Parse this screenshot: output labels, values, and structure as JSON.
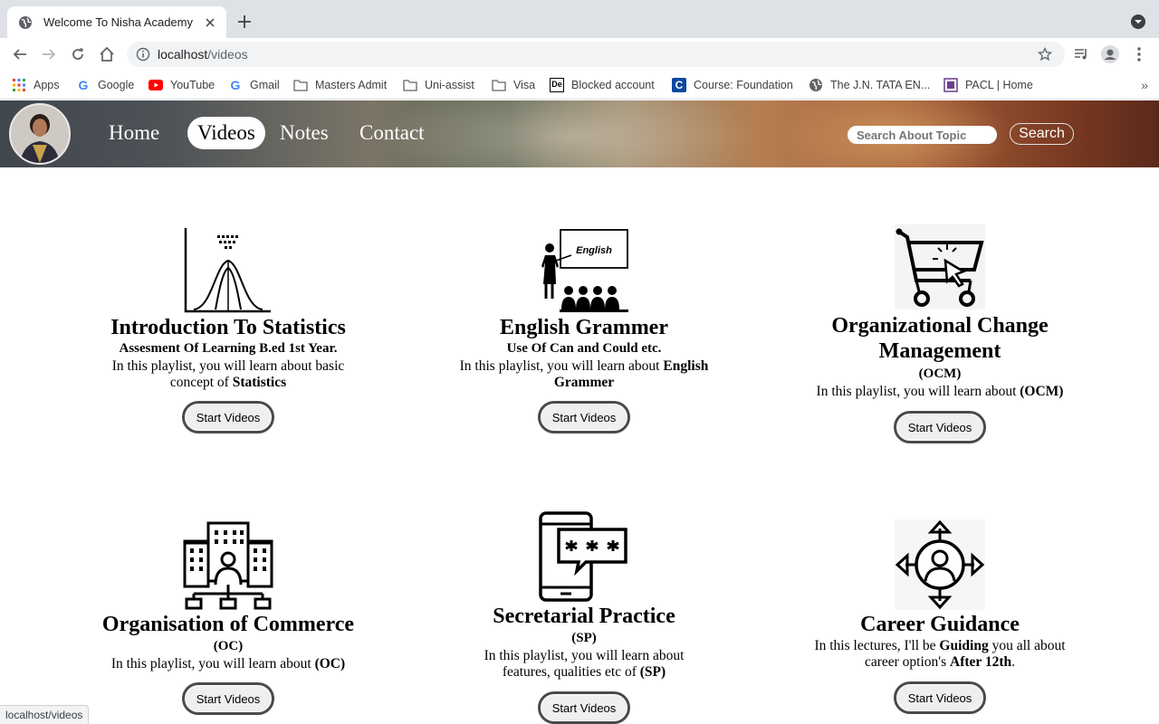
{
  "browser": {
    "tab_title": "Welcome To Nisha Academy",
    "url_host": "localhost",
    "url_path": "/videos",
    "bookmarks": [
      {
        "label": "Apps",
        "icon": "apps-grid-icon"
      },
      {
        "label": "Google",
        "icon": "google-icon"
      },
      {
        "label": "YouTube",
        "icon": "youtube-icon"
      },
      {
        "label": "Gmail",
        "icon": "google-icon"
      },
      {
        "label": "Masters Admit",
        "icon": "folder-icon"
      },
      {
        "label": "Uni-assist",
        "icon": "folder-icon"
      },
      {
        "label": "Visa",
        "icon": "folder-icon"
      },
      {
        "label": "Blocked account",
        "icon": "deutsche-bank-icon"
      },
      {
        "label": "Course: Foundation",
        "icon": "coursera-icon"
      },
      {
        "label": "The J.N. TATA EN...",
        "icon": "globe-icon"
      },
      {
        "label": "PACL | Home",
        "icon": "pacl-icon"
      }
    ],
    "status_url": "localhost/videos"
  },
  "site": {
    "nav": [
      {
        "label": "Home",
        "active": false
      },
      {
        "label": "Videos",
        "active": true
      },
      {
        "label": "Notes",
        "active": false
      },
      {
        "label": "Contact",
        "active": false
      }
    ],
    "search_placeholder": "Search About Topic",
    "search_button": "Search"
  },
  "cards": [
    {
      "title": "Introduction To Statistics",
      "subtitle": "Assesment Of Learning B.ed 1st Year.",
      "desc_prefix": "In this playlist, you will learn about basic concept of ",
      "desc_bold": "Statistics",
      "desc_suffix": "",
      "button": "Start Videos",
      "icon": "bell-curve-icon"
    },
    {
      "title": "English Grammer",
      "subtitle": "Use Of Can and Could etc.",
      "desc_prefix": "In this playlist, you will learn about ",
      "desc_bold": "English Grammer",
      "desc_suffix": "",
      "button": "Start Videos",
      "icon": "classroom-icon",
      "board_text": "English"
    },
    {
      "title": "Organizational Change Management",
      "subtitle": "(OCM)",
      "desc_prefix": "In this playlist, you will learn about ",
      "desc_bold": "(OCM)",
      "desc_suffix": "",
      "button": "Start Videos",
      "icon": "shopping-cart-icon"
    },
    {
      "title": "Organisation of Commerce",
      "subtitle": "(OC)",
      "desc_prefix": "In this playlist, you will learn about ",
      "desc_bold": "(OC)",
      "desc_suffix": "",
      "button": "Start Videos",
      "icon": "office-buildings-icon"
    },
    {
      "title": "Secretarial Practice",
      "subtitle": "(SP)",
      "desc_prefix": "In this playlist, you will learn about features, qualities etc of ",
      "desc_bold": "(SP)",
      "desc_suffix": "",
      "button": "Start Videos",
      "icon": "phone-password-icon"
    },
    {
      "title": "Career Guidance",
      "subtitle": "",
      "desc_prefix": "In this lectures, I'll be ",
      "desc_bold": "Guiding",
      "desc_suffix": " you all about career option's ",
      "desc_bold2": "After 12th",
      "desc_end": ".",
      "button": "Start Videos",
      "icon": "career-direction-icon"
    }
  ]
}
